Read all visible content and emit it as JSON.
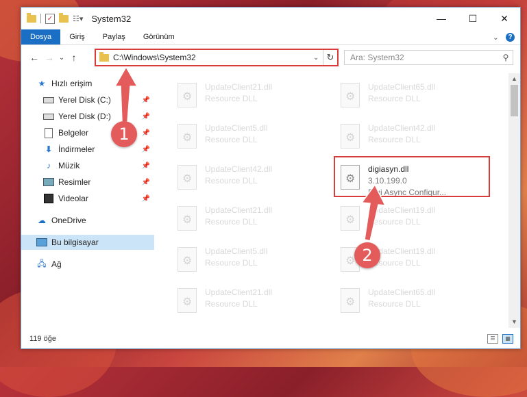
{
  "window": {
    "title": "System32",
    "controls": {
      "minimize": "—",
      "maximize": "☐",
      "close": "✕"
    }
  },
  "ribbon": {
    "tabs": [
      "Dosya",
      "Giriş",
      "Paylaş",
      "Görünüm"
    ],
    "expand_icon": "chevron-down-icon",
    "help": "?"
  },
  "navigation": {
    "back": "←",
    "forward": "→",
    "recent": "⌄",
    "up": "↑",
    "address": "C:\\Windows\\System32",
    "refresh": "↻",
    "search_placeholder": "Ara: System32"
  },
  "sidebar": {
    "items": [
      {
        "label": "Hızlı erişim",
        "icon": "star-icon",
        "pinned": false
      },
      {
        "label": "Yerel Disk (C:)",
        "icon": "drive-icon",
        "pinned": true
      },
      {
        "label": "Yerel Disk (D:)",
        "icon": "drive-icon",
        "pinned": true
      },
      {
        "label": "Belgeler",
        "icon": "documents-icon",
        "pinned": true
      },
      {
        "label": "İndirmeler",
        "icon": "download-icon",
        "pinned": true
      },
      {
        "label": "Müzik",
        "icon": "music-icon",
        "pinned": true
      },
      {
        "label": "Resimler",
        "icon": "pictures-icon",
        "pinned": true
      },
      {
        "label": "Videolar",
        "icon": "videos-icon",
        "pinned": true
      },
      {
        "label": "OneDrive",
        "icon": "cloud-icon",
        "pinned": false
      },
      {
        "label": "Bu bilgisayar",
        "icon": "computer-icon",
        "pinned": false,
        "selected": true
      },
      {
        "label": "Ağ",
        "icon": "network-icon",
        "pinned": false
      }
    ]
  },
  "files": {
    "left_column": [
      {
        "name": "UpdateClient21.dll",
        "sub": "Resource DLL"
      },
      {
        "name": "UpdateClient5.dll",
        "sub": "Resource DLL"
      },
      {
        "name": "UpdateClient42.dll",
        "sub": "Resource DLL"
      },
      {
        "name": "UpdateClient21.dll",
        "sub": "Resource DLL"
      },
      {
        "name": "UpdateClient5.dll",
        "sub": "Resource DLL"
      },
      {
        "name": "UpdateClient21.dll",
        "sub": "Resource DLL"
      }
    ],
    "right_column": [
      {
        "name": "UpdateClient65.dll",
        "sub": "Resource DLL"
      },
      {
        "name": "UpdateClient42.dll",
        "sub": "Resource DLL"
      },
      {
        "name": "digiasyn.dll",
        "version": "3.10.199.0",
        "description": "Digi Async Configur...",
        "highlighted": true
      },
      {
        "name": "UpdateClient19.dll",
        "sub": "Resource DLL"
      },
      {
        "name": "UpdateClient19.dll",
        "sub": "Resource DLL"
      },
      {
        "name": "UpdateClient65.dll",
        "sub": "Resource DLL"
      }
    ]
  },
  "status": {
    "count": "119 öğe"
  },
  "annotations": {
    "marker1": "1",
    "marker2": "2",
    "color": "#e35b5b"
  }
}
